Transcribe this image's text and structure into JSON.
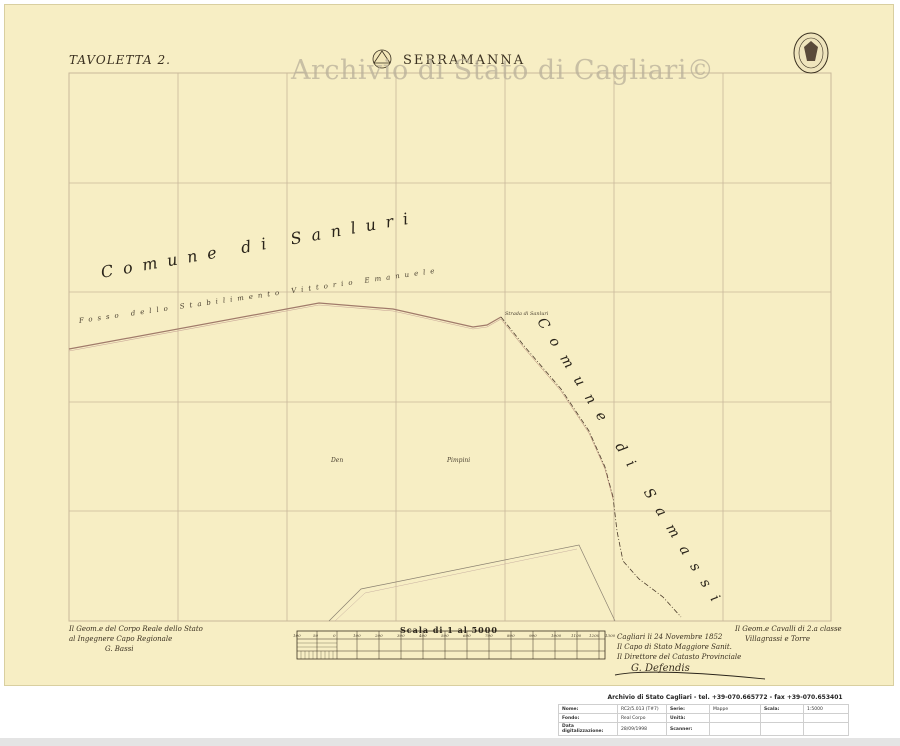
{
  "map": {
    "tavoletta": "TAVOLETTA 2.",
    "sheet_name": "SERRAMANNA",
    "watermark": "Archivio di Stato di Cagliari©",
    "comune_sanluri": "Comune di Sanluri",
    "comune_samassi": "Comune di Samassi",
    "fosso": "Fosso dello Stabilimento Vittorio Emanuele",
    "strada": "Strada di Sanluri",
    "den_pimpini": [
      "Den",
      "Pimpini"
    ],
    "scale_title": "Scala di 1 al 5000",
    "scale_ticks": [
      "100",
      "50",
      "0",
      "100",
      "200",
      "300",
      "400",
      "500",
      "600",
      "700",
      "800",
      "900",
      "1000",
      "1100",
      "1200",
      "1300"
    ],
    "notes_left": [
      "Il Geom.e del Corpo Reale dello Stato",
      "al Ingegnere Capo Regionale",
      "G. Bassi"
    ],
    "notes_center": [
      "Cagliari li 24 Novembre 1852",
      "Il Capo di Stato Maggiore Sanit.",
      "Il Direttore del Catasto Provinciale"
    ],
    "notes_right": [
      "Il Geom.e Cavalli di 2.a classe",
      "Villagrassi e Torre"
    ],
    "signature": "G. Defendis",
    "colors": {
      "paper": "#f7eec4",
      "grid": "#c8b89a",
      "boundary": "#a07a6a",
      "ink": "#2a241a"
    }
  },
  "infobar": {
    "header": "Archivio di Stato Cagliari - tel. +39-070.665772 - fax +39-070.653401",
    "rows": [
      [
        {
          "k": "Nome:",
          "v": "RC2/5.013 (T#7)"
        },
        {
          "k": "Serie:",
          "v": "Mappe"
        },
        {
          "k": "Scala:",
          "v": "1:5000"
        }
      ],
      [
        {
          "k": "Fondo:",
          "v": "Real Corpo"
        },
        {
          "k": "Unità:",
          "v": ""
        },
        {
          "k": "",
          "v": ""
        }
      ],
      [
        {
          "k": "Data digitalizzazione:",
          "v": "28/09/1998"
        },
        {
          "k": "Scanner:",
          "v": ""
        },
        {
          "k": "",
          "v": ""
        }
      ]
    ]
  }
}
